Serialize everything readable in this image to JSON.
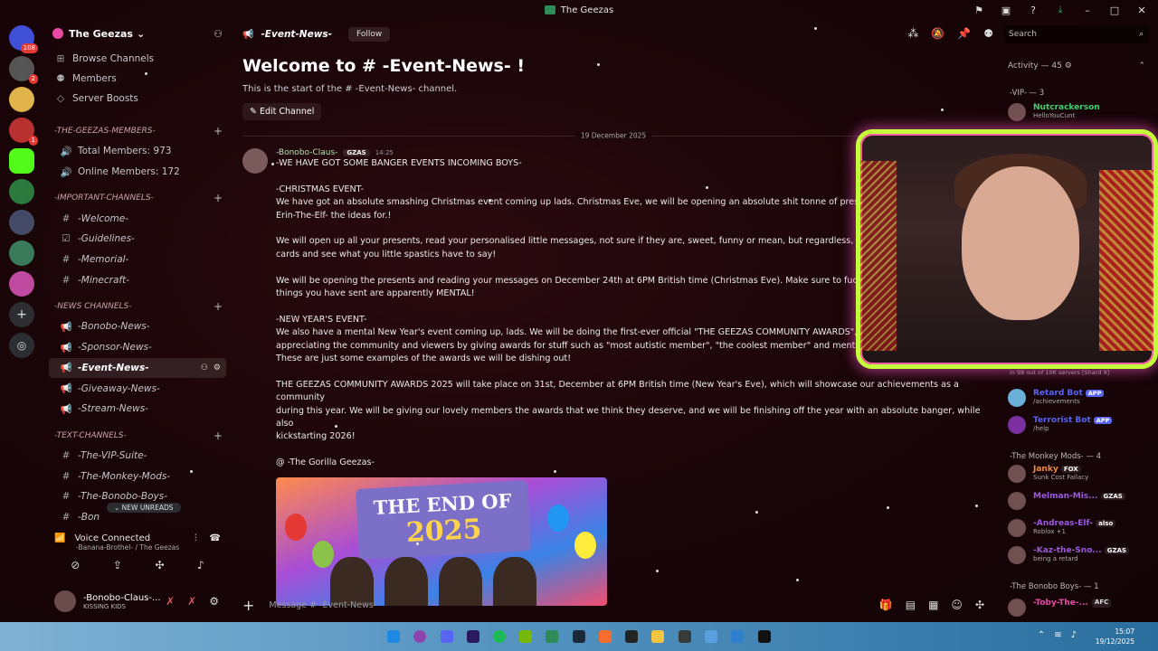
{
  "window": {
    "title": "The Geezas"
  },
  "server_list": {
    "badge_count": "108",
    "badge_small_1": "2",
    "badge_small_2": "1"
  },
  "sidebar": {
    "guild_name": "The Geezas",
    "nav": [
      {
        "label": "Browse Channels",
        "icon": "compass-icon"
      },
      {
        "label": "Members",
        "icon": "members-icon"
      },
      {
        "label": "Server Boosts",
        "icon": "boost-icon"
      }
    ],
    "cat_members": "-THE-GEEZAS-MEMBERS-",
    "stat_total": "Total Members: 973",
    "stat_online": "Online Members: 172",
    "cat_important": "-IMPORTANT-CHANNELS-",
    "important": [
      "-Welcome-",
      "-Guidelines-",
      "-Memorial-",
      "-Minecraft-"
    ],
    "cat_news": "-NEWS CHANNELS-",
    "news": [
      "-Bonobo-News-",
      "-Sponsor-News-",
      "-Event-News-",
      "-Giveaway-News-",
      "-Stream-News-"
    ],
    "cat_text": "-TEXT-CHANNELS-",
    "text": [
      "-The-VIP-Suite-",
      "-The-Monkey-Mods-",
      "-The-Bonobo-Boys-",
      "-Bon"
    ],
    "new_unreads": "NEW UNREADS"
  },
  "voice": {
    "title": "Voice Connected",
    "sub": "-Banana-Brothel- / The Geezas"
  },
  "user": {
    "name": "-Bonobo-Claus-...",
    "status": "KISSING KIDS"
  },
  "channel": {
    "name": "-Event-News-",
    "follow": "Follow",
    "welcome": "Welcome to # -Event-News- !",
    "welcome_sub": "This is the start of the # -Event-News- channel.",
    "edit": "Edit Channel",
    "date_divider": "19 December 2025"
  },
  "message": {
    "author": "-Bonobo-Claus-",
    "tag": "GZAS",
    "time": "14:25",
    "lines": [
      "-WE HAVE GOT SOME BANGER EVENTS INCOMING BOYS-",
      "",
      "-CHRISTMAS EVENT-",
      "We have got an absolute smashing Christmas event coming up lads. Christmas Eve, we will be opening an absolute shit tonne of presents tha",
      "Erin-The-Elf- the ideas for.!",
      "",
      "We will open up all your presents, read your personalised little messages, not sure if they are, sweet, funny or mean, but regardless, we will re",
      "cards and see what you little spastics have to say!",
      "",
      "We will be opening the presents and reading your messages on December 24th at 6PM British time (Christmas Eve). Make sure to fucking be",
      "things you have sent are apparently MENTAL!",
      "",
      "-NEW YEAR'S EVENT-",
      "We also have a mental New Year's event coming up, lads. We will be doing the first-ever official \"THE GEEZAS COMMUNITY AWARDS\", which",
      "appreciating the community and viewers by giving awards for stuff such as \"most autistic member\", \"the coolest member\" and mental ones li",
      "These are just some examples of the awards we will be dishing out!",
      "",
      "THE GEEZAS COMMUNITY AWARDS 2025 will take place on 31st, December at 6PM British time (New Year's Eve), which will showcase our achievements as a community",
      "during this year. We will be giving our lovely members the awards that we think they deserve, and we will be finishing off the year with an absolute banger, while also",
      "kickstarting 2026!",
      "",
      "@ -The Gorilla Geezas-"
    ],
    "image_line1": "THE END OF",
    "image_line2": "2025"
  },
  "composer": {
    "placeholder": "Message # -Event-News-"
  },
  "right": {
    "search": "Search",
    "activity": "Activity — 45",
    "vip_header": "-VIP- — 3",
    "vip_user": "Nutcrackerson",
    "vip_user_status": "HelloYouCunt",
    "bot_note": "in 98 out of 10K servers [Shard 9]",
    "bot1": "Retard Bot",
    "bot1_status": "/achievements",
    "bot2": "Terrorist Bot",
    "bot2_status": "/help",
    "app_badge": "APP",
    "mods_header": "-The Monkey Mods- — 4",
    "mods": [
      {
        "name": "Janky",
        "tag": "FOX",
        "status": "Sunk Cost Fallacy",
        "color": "#f08a3c"
      },
      {
        "name": "Melman-Mis...",
        "tag": "GZAS",
        "status": "",
        "color": "#9b59e0"
      },
      {
        "name": "-Andreas-Elf-",
        "tag": "also",
        "status": "Roblox +1",
        "color": "#9b59e0"
      },
      {
        "name": "-Kaz-the-Sno...",
        "tag": "GZAS",
        "status": "being a retard",
        "color": "#9b59e0"
      }
    ],
    "boys_header": "-The Bonobo Boys- — 1",
    "boys_user": "-Toby-The-...",
    "boys_tag": "AFC"
  },
  "taskbar": {
    "time": "15:07",
    "date": "19/12/2025"
  },
  "colors": {
    "accent": "#5865f2",
    "webcam_border": "#c4ff3a",
    "mention": "#c9a7ff"
  }
}
